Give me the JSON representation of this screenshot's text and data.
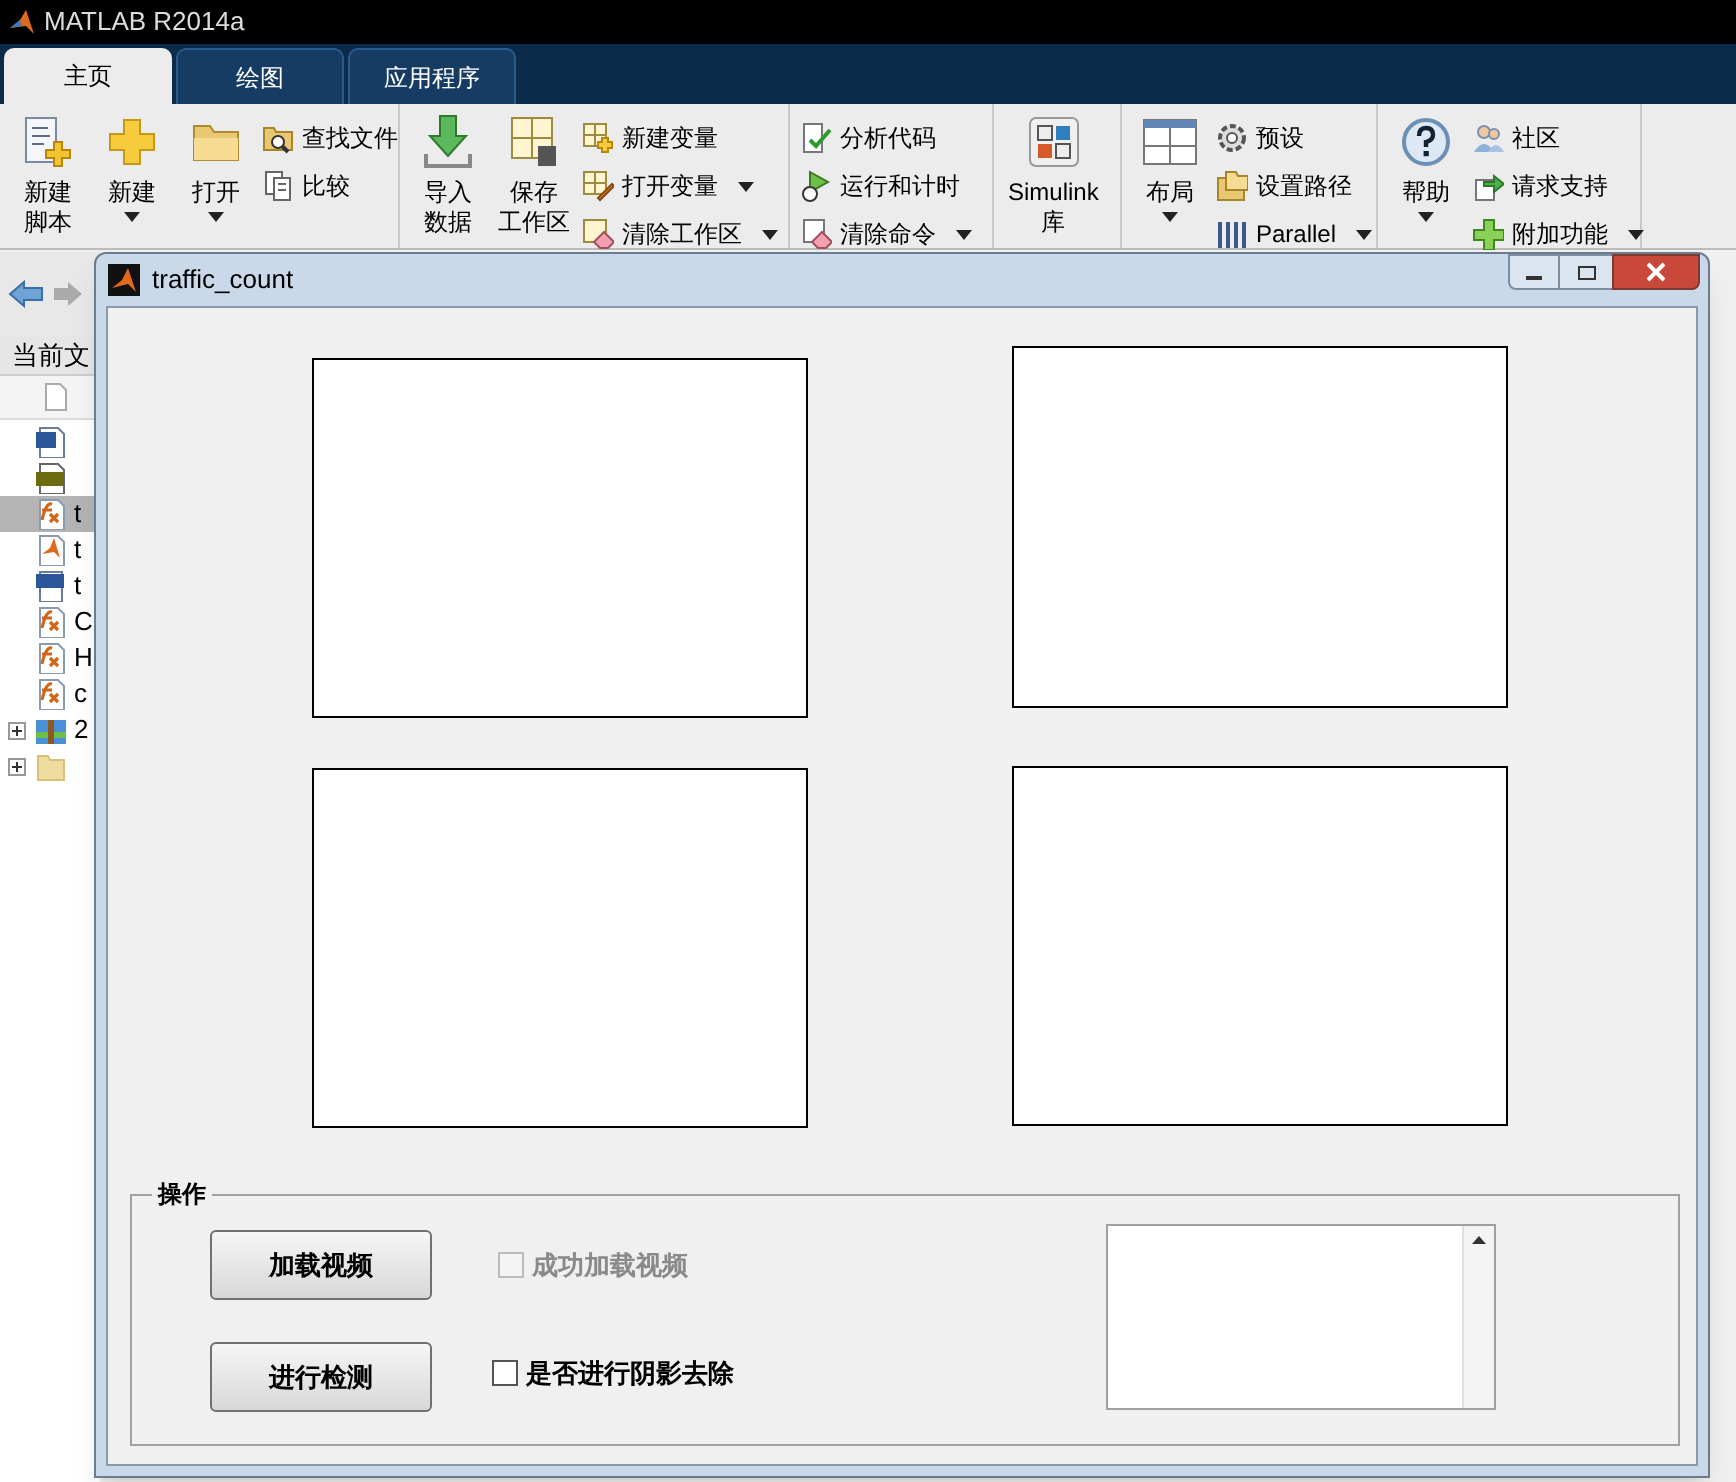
{
  "app": {
    "title": "MATLAB R2014a"
  },
  "tabs": [
    {
      "label": "主页",
      "selected": true
    },
    {
      "label": "绘图",
      "selected": false
    },
    {
      "label": "应用程序",
      "selected": false
    }
  ],
  "ribbon": [
    {
      "items": [
        {
          "kind": "big",
          "lines": [
            "新建",
            "脚本"
          ]
        },
        {
          "kind": "big",
          "lines": [
            "新建"
          ],
          "dropdown": true
        },
        {
          "kind": "big",
          "lines": [
            "打开"
          ],
          "dropdown": true
        },
        {
          "kind": "small",
          "label": "查找文件"
        },
        {
          "kind": "small",
          "label": "比较"
        }
      ]
    },
    {
      "items": [
        {
          "kind": "big",
          "lines": [
            "导入",
            "数据"
          ]
        },
        {
          "kind": "big",
          "lines": [
            "保存",
            "工作区"
          ]
        },
        {
          "kind": "small",
          "label": "新建变量"
        },
        {
          "kind": "small",
          "label": "打开变量",
          "dropdown": true
        },
        {
          "kind": "small",
          "label": "清除工作区",
          "dropdown": true
        }
      ]
    },
    {
      "items": [
        {
          "kind": "small",
          "label": "分析代码"
        },
        {
          "kind": "small",
          "label": "运行和计时"
        },
        {
          "kind": "small",
          "label": "清除命令",
          "dropdown": true
        }
      ]
    },
    {
      "items": [
        {
          "kind": "big",
          "lines": [
            "Simulink",
            "库"
          ]
        }
      ]
    },
    {
      "items": [
        {
          "kind": "big",
          "lines": [
            "布局"
          ],
          "dropdown": true
        },
        {
          "kind": "small",
          "label": "预设"
        },
        {
          "kind": "small",
          "label": "设置路径"
        },
        {
          "kind": "small",
          "label": "Parallel",
          "dropdown": true
        }
      ]
    },
    {
      "items": [
        {
          "kind": "big",
          "lines": [
            "帮助"
          ],
          "dropdown": true
        },
        {
          "kind": "small",
          "label": "社区"
        },
        {
          "kind": "small",
          "label": "请求支持"
        },
        {
          "kind": "small",
          "label": "附加功能",
          "dropdown": true
        }
      ]
    }
  ],
  "folder_panel": {
    "label": "当前文",
    "files": [
      {
        "kind": "doc",
        "selected": false
      },
      {
        "kind": "image",
        "selected": false
      },
      {
        "kind": "function",
        "text": "t",
        "selected": true
      },
      {
        "kind": "figure",
        "text": "t",
        "selected": false
      },
      {
        "kind": "video",
        "text": "t",
        "selected": false
      },
      {
        "kind": "function",
        "text": "C",
        "selected": false
      },
      {
        "kind": "function",
        "text": "H",
        "selected": false
      },
      {
        "kind": "function",
        "text": "c",
        "selected": false
      },
      {
        "kind": "archive",
        "text": "2",
        "selected": false
      },
      {
        "kind": "folder",
        "selected": false
      }
    ]
  },
  "dialog": {
    "title": "traffic_count",
    "panel": {
      "title": "操作",
      "buttons": [
        "加载视频",
        "进行检测"
      ],
      "checkboxes": [
        {
          "label": "成功加载视频",
          "checked": false,
          "disabled": true
        },
        {
          "label": "是否进行阴影去除",
          "checked": false,
          "disabled": false
        }
      ]
    }
  }
}
